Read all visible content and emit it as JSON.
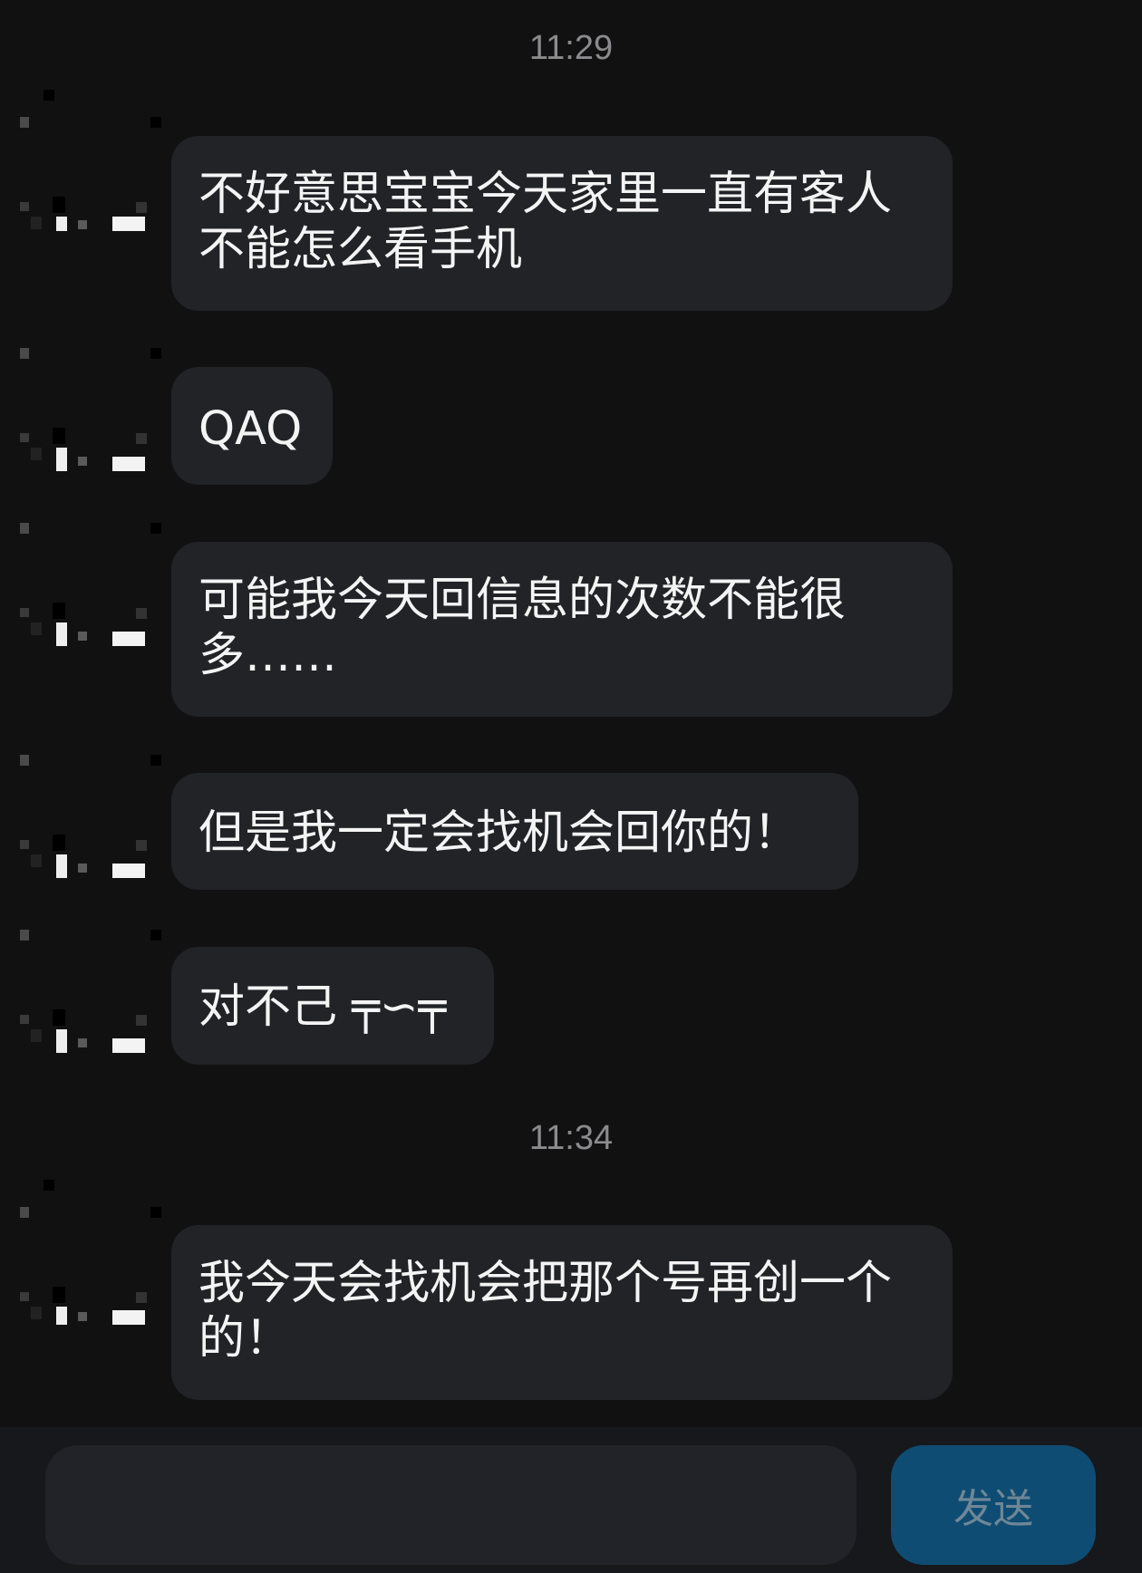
{
  "timestamps": [
    "11:29",
    "11:34"
  ],
  "messages": [
    {
      "text": "不好意思宝宝今天家里一直有客人不能怎么看手机"
    },
    {
      "text": "QAQ"
    },
    {
      "text": "可能我今天回信息的次数不能很多……"
    },
    {
      "text": "但是我一定会找机会回你的！"
    },
    {
      "text": "对不己 ╤∽╤"
    },
    {
      "text": "我今天会找机会把那个号再创一个的！"
    }
  ],
  "composer": {
    "input_value": "",
    "send_label": "发送"
  },
  "colors": {
    "background": "#111112",
    "bubble": "#222327",
    "send_button": "#0e4c73",
    "timestamp": "#8b8b8d"
  }
}
